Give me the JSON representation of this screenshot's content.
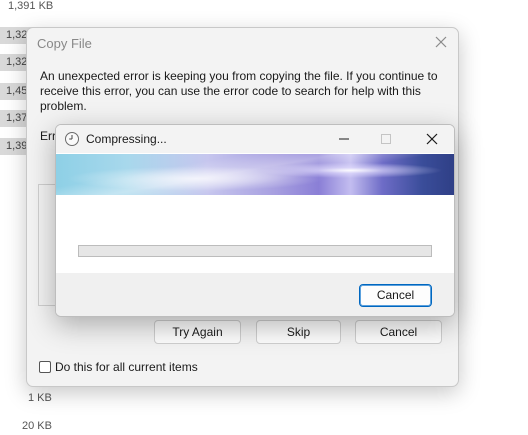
{
  "background_list": {
    "sizes_top": [
      "1,391 KB"
    ],
    "cells": [
      "1,32",
      "1,32",
      "1,45",
      "1,37",
      "1,39"
    ],
    "sizes_bottom": [
      "1 KB",
      "20 KB"
    ]
  },
  "copy_dialog": {
    "title": "Copy File",
    "message": "An unexpected error is keeping you from copying the file. If you continue to receive this error, you can use the error code to search for help with this problem.",
    "error_label_partial": "Err",
    "buttons": {
      "try_again": "Try Again",
      "skip": "Skip",
      "cancel": "Cancel"
    },
    "checkbox_label": "Do this for all current items",
    "checkbox_checked": false
  },
  "compress_dialog": {
    "title": "Compressing...",
    "progress_percent": 0,
    "cancel_label": "Cancel",
    "accent_color": "#0067c0",
    "progress_color": "#06b025"
  },
  "icons": {
    "copy_close": "close-icon",
    "compress_title": "clock-icon",
    "minimize": "minimize-icon",
    "maximize": "maximize-icon",
    "close": "close-icon"
  }
}
